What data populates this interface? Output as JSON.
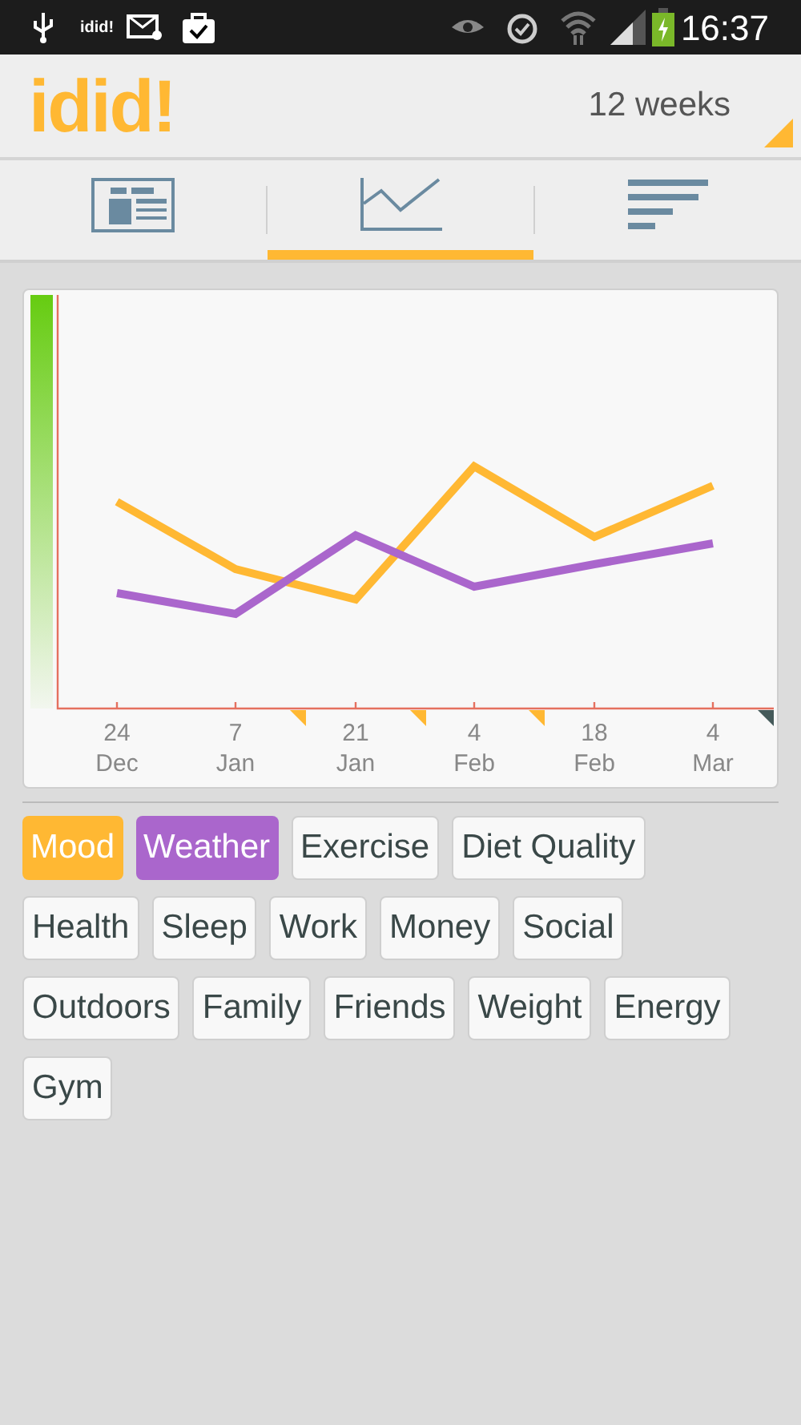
{
  "status_bar": {
    "notification_text": "idid!",
    "time": "16:37"
  },
  "header": {
    "logo": "idid!",
    "period": "12 weeks"
  },
  "tabs": [
    {
      "kind": "journal",
      "selected": false
    },
    {
      "kind": "chart",
      "selected": true
    },
    {
      "kind": "list",
      "selected": false
    }
  ],
  "chart": {
    "x_labels": [
      {
        "day": "24",
        "month": "Dec"
      },
      {
        "day": "7",
        "month": "Jan"
      },
      {
        "day": "21",
        "month": "Jan"
      },
      {
        "day": "4",
        "month": "Feb"
      },
      {
        "day": "18",
        "month": "Feb"
      },
      {
        "day": "4",
        "month": "Mar"
      }
    ]
  },
  "tags": [
    {
      "label": "Mood",
      "selected": true,
      "color": "#ffb833"
    },
    {
      "label": "Weather",
      "selected": true,
      "color": "#aa66cc"
    },
    {
      "label": "Exercise",
      "selected": false
    },
    {
      "label": "Diet Quality",
      "selected": false
    },
    {
      "label": "Health",
      "selected": false
    },
    {
      "label": "Sleep",
      "selected": false
    },
    {
      "label": "Work",
      "selected": false
    },
    {
      "label": "Money",
      "selected": false
    },
    {
      "label": "Social",
      "selected": false
    },
    {
      "label": "Outdoors",
      "selected": false
    },
    {
      "label": "Family",
      "selected": false
    },
    {
      "label": "Friends",
      "selected": false
    },
    {
      "label": "Weight",
      "selected": false
    },
    {
      "label": "Energy",
      "selected": false
    },
    {
      "label": "Gym",
      "selected": false
    }
  ]
}
